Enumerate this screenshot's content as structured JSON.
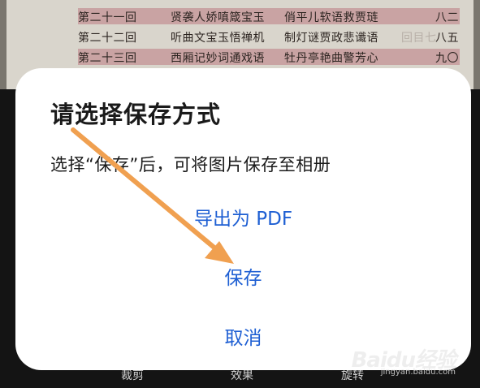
{
  "background_document": {
    "rows": [
      {
        "chapter": "第二十一回",
        "title_a": "贤袭人娇嗔箴宝玉",
        "title_b": "俏平儿软语救贾琏",
        "page": "八二",
        "faint": "",
        "highlight": true
      },
      {
        "chapter": "第二十二回",
        "title_a": "听曲文宝玉悟禅机",
        "title_b": "制灯谜贾政悲谶语",
        "page": "八五",
        "faint": "回目七",
        "highlight": false
      },
      {
        "chapter": "第二十三回",
        "title_a": "西厢记妙词通戏语",
        "title_b": "牡丹亭艳曲警芳心",
        "page": "九〇",
        "faint": "",
        "highlight": true
      }
    ]
  },
  "toolbar": {
    "crop_label": "裁剪",
    "effect_label": "效果",
    "rotate_label": "旋转"
  },
  "watermark": {
    "logo": "Baidu经验",
    "url": "jingyan.baidu.com"
  },
  "dialog": {
    "title": "请选择保存方式",
    "message": "选择“保存”后，可将图片保存至相册",
    "export_pdf_label": "导出为 PDF",
    "save_label": "保存",
    "cancel_label": "取消"
  },
  "colors": {
    "accent_blue": "#1e5fd3",
    "annotation_arrow": "#f0a050",
    "row_highlight": "#c9a3a3"
  }
}
